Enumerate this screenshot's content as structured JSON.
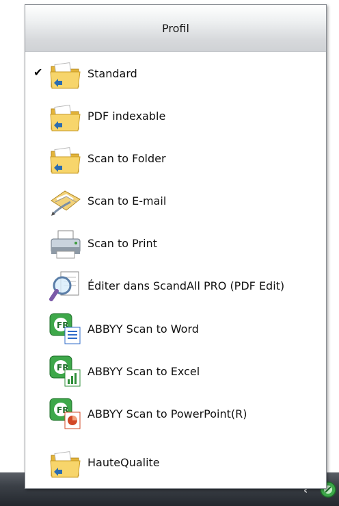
{
  "menu": {
    "title": "Profil",
    "items": [
      {
        "label": "Standard",
        "icon": "folder-icon",
        "checked": true
      },
      {
        "label": "PDF indexable",
        "icon": "folder-icon",
        "checked": false
      },
      {
        "label": "Scan to Folder",
        "icon": "folder-icon",
        "checked": false
      },
      {
        "label": "Scan to E-mail",
        "icon": "email-icon",
        "checked": false
      },
      {
        "label": "Scan to Print",
        "icon": "printer-icon",
        "checked": false
      },
      {
        "label": "Éditer dans ScandAll PRO (PDF Edit)",
        "icon": "magnifier-icon",
        "checked": false
      },
      {
        "label": "ABBYY Scan to Word",
        "icon": "abbyy-word-icon",
        "checked": false
      },
      {
        "label": "ABBYY Scan to Excel",
        "icon": "abbyy-excel-icon",
        "checked": false
      },
      {
        "label": "ABBYY Scan to PowerPoint(R)",
        "icon": "abbyy-powerpoint-icon",
        "checked": false
      },
      {
        "label": "HauteQualite",
        "icon": "folder-icon",
        "checked": false
      }
    ],
    "check_mark": "✔"
  },
  "taskbar": {
    "chevron": "‹",
    "tray_icon": "scanner-tray-icon"
  },
  "colors": {
    "folder": "#f2c94c",
    "abbyy_green": "#3ea84a",
    "word_blue": "#2f6bc9",
    "excel_green": "#2f8f3a",
    "ppt_red": "#d24726"
  }
}
